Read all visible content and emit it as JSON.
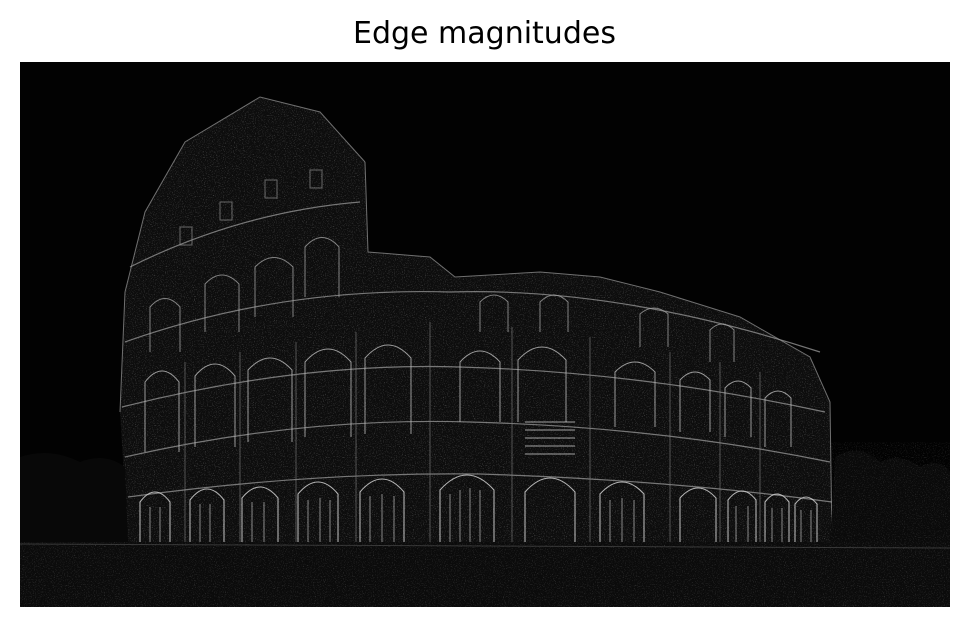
{
  "figure": {
    "title": "Edge magnitudes"
  },
  "image": {
    "subject": "colosseum-edge-map",
    "background_color": "#020202",
    "edge_color": "#ffffff"
  }
}
